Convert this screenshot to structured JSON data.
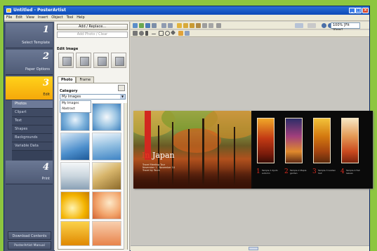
{
  "window": {
    "title": "Untitled - PosterArtist"
  },
  "menu": [
    "File",
    "Edit",
    "View",
    "Insert",
    "Object",
    "Tool",
    "Help"
  ],
  "steps": [
    {
      "num": "1",
      "label": "Select Template"
    },
    {
      "num": "2",
      "label": "Paper Options"
    },
    {
      "num": "3",
      "label": "Edit"
    },
    {
      "num": "4",
      "label": "Print"
    }
  ],
  "subnav": [
    "Photos",
    "Clipart",
    "Text",
    "Shapes",
    "Backgrounds",
    "Variable Data"
  ],
  "bottom_buttons": {
    "download": "Download Contents",
    "manual": "PosterArtist Manual"
  },
  "panel": {
    "add_replace": "Add / Replace...",
    "add_photo_placeholder": "Add Photo / Clear",
    "edit_image": "Edit Image",
    "tabs": [
      "Photo",
      "Frame"
    ],
    "category_label": "Category",
    "category_value": "My Images",
    "category_options": [
      "My Images",
      "Abstract"
    ]
  },
  "toolbar": {
    "zoom": "100% [Fit View]"
  },
  "poster": {
    "title_prefix": "In",
    "title_main": "Japan",
    "travel_line1": "Travel Meeting Tour",
    "travel_line2": "November 1 - November 10",
    "travel_line3": "Travel by Tours",
    "numbers": [
      "1",
      "2",
      "3",
      "4"
    ],
    "captions": [
      "Temple 1 Kyoto autumn",
      "Temple 2 Maple garden",
      "Temple 3 Golden hall",
      "Temple 4 Fall leaves"
    ]
  },
  "colors": {
    "accent_yellow": "#f5a80a",
    "poster_red": "#d2281f",
    "title_blue": "#0b48b8"
  }
}
